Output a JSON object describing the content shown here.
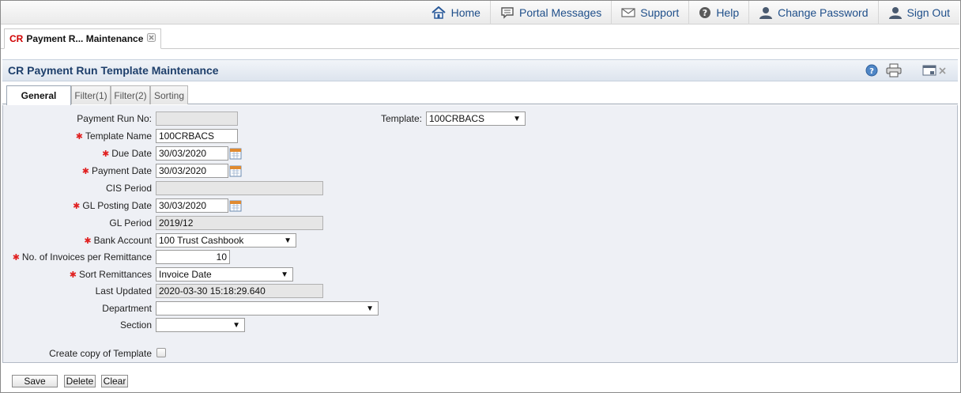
{
  "nav": {
    "home": "Home",
    "portal_messages": "Portal Messages",
    "support": "Support",
    "help": "Help",
    "change_password": "Change Password",
    "sign_out": "Sign Out"
  },
  "doc_tab": {
    "prefix": "CR",
    "label": "Payment R... Maintenance"
  },
  "page": {
    "title": "CR Payment Run Template Maintenance"
  },
  "tabs": [
    "General",
    "Filter(1)",
    "Filter(2)",
    "Sorting"
  ],
  "form": {
    "payment_run_no": {
      "label": "Payment Run No:",
      "value": ""
    },
    "template": {
      "label": "Template:",
      "value": "100CRBACS"
    },
    "template_name": {
      "label": "Template Name",
      "value": "100CRBACS"
    },
    "due_date": {
      "label": "Due Date",
      "value": "30/03/2020"
    },
    "payment_date": {
      "label": "Payment Date",
      "value": "30/03/2020"
    },
    "cis_period": {
      "label": "CIS Period",
      "value": ""
    },
    "gl_posting_date": {
      "label": "GL Posting Date",
      "value": "30/03/2020"
    },
    "gl_period": {
      "label": "GL Period",
      "value": "2019/12"
    },
    "bank_account": {
      "label": "Bank Account",
      "value": "100 Trust Cashbook"
    },
    "invoices_per_remittance": {
      "label": "No. of Invoices per Remittance",
      "value": "10"
    },
    "sort_remittances": {
      "label": "Sort Remittances",
      "value": "Invoice Date"
    },
    "last_updated": {
      "label": "Last Updated",
      "value": "2020-03-30 15:18:29.640"
    },
    "department": {
      "label": "Department",
      "value": ""
    },
    "section": {
      "label": "Section",
      "value": ""
    },
    "create_copy": {
      "label": "Create copy of Template",
      "checked": false
    }
  },
  "buttons": {
    "save": "Save",
    "delete": "Delete",
    "clear": "Clear"
  },
  "required_marker": "✱",
  "dropdown_arrow": "▼",
  "colors": {
    "link": "#1f4f8a",
    "title": "#1e3f6b",
    "required": "#e02020",
    "cr_prefix": "#d00000"
  }
}
